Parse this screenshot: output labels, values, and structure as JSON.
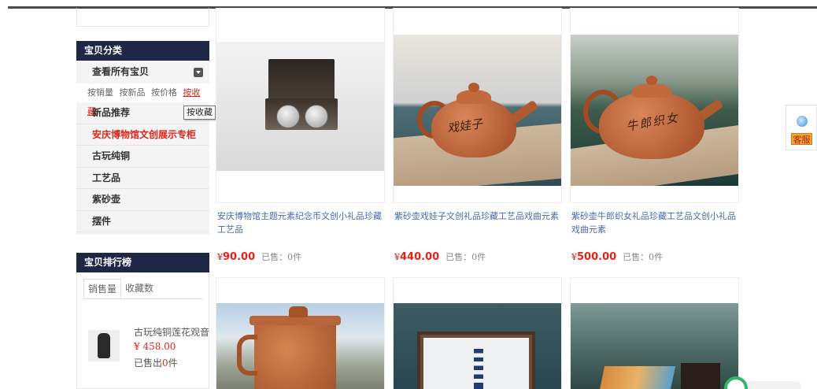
{
  "sidebar": {
    "category_title": "宝贝分类",
    "all_label": "查看所有宝贝",
    "sort_options": [
      "按销量",
      "按新品",
      "按价格",
      "按收藏"
    ],
    "tooltip": "按收藏",
    "categories": [
      {
        "label": "新品推荐"
      },
      {
        "label": "安庆博物馆文创展示专柜"
      },
      {
        "label": "古玩纯铜"
      },
      {
        "label": "工艺品"
      },
      {
        "label": "紫砂壶"
      },
      {
        "label": "摆件"
      }
    ],
    "ranking_title": "宝贝排行榜",
    "ranking_tabs": [
      "销售量",
      "收藏数"
    ],
    "ranking_item": {
      "name": "古玩纯铜莲花观音",
      "price": "¥ 458.00",
      "sold_prefix": "已售出",
      "sold_count": "0",
      "sold_suffix": "件"
    }
  },
  "products": [
    {
      "title": "安庆博物馆主题元素纪念币文创小礼品珍藏工艺品",
      "currency": "¥",
      "price": "90.00",
      "sold": "已售：0件"
    },
    {
      "title": "紫砂壶戏娃子文创礼品珍藏工艺品戏曲元素",
      "currency": "¥",
      "price": "440.00",
      "sold": "已售：0件",
      "pot_text": "戏娃子"
    },
    {
      "title": "紫砂壶牛郎织女礼品珍藏工艺品文创小礼品戏曲元素",
      "currency": "¥",
      "price": "500.00",
      "sold": "已售：0件",
      "pot_text": "牛郎织女"
    }
  ],
  "service": {
    "label": "客服"
  },
  "colors": {
    "nav_dark": "#1f2747",
    "accent_red": "#e2231a",
    "link_blue": "#4a6ab0"
  }
}
